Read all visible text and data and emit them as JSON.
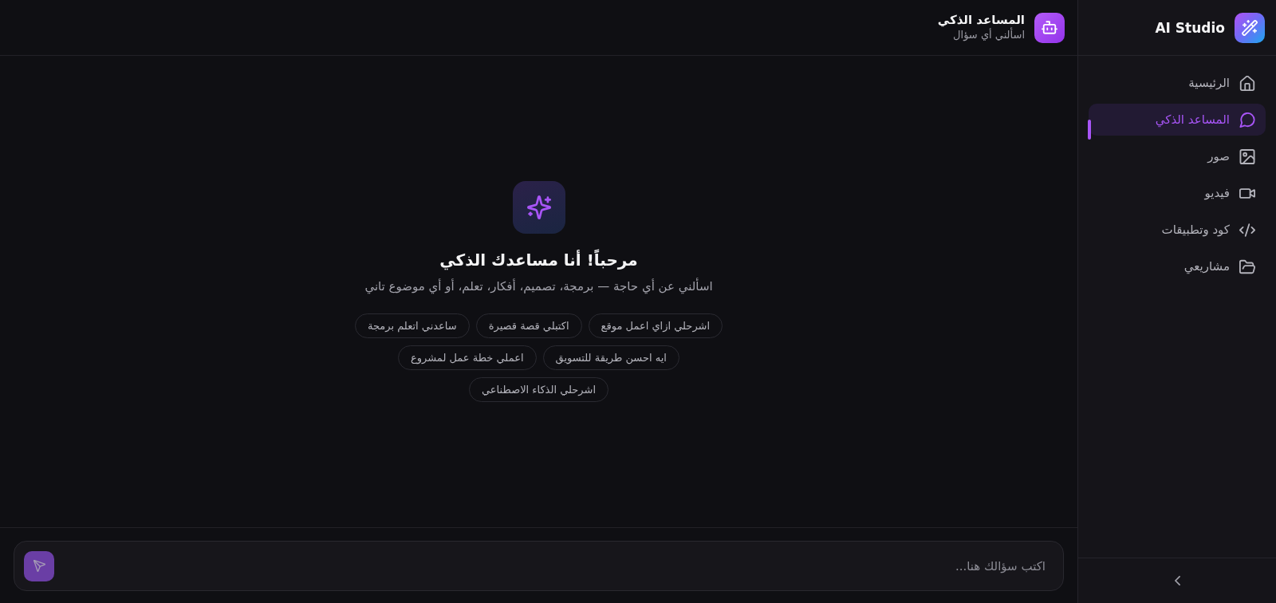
{
  "sidebar": {
    "app_title": "AI Studio",
    "items": [
      {
        "label": "الرئيسية",
        "selected": false
      },
      {
        "label": "المساعد الذكي",
        "selected": true
      },
      {
        "label": "صور",
        "selected": false
      },
      {
        "label": "فيديو",
        "selected": false
      },
      {
        "label": "كود وتطبيقات",
        "selected": false
      },
      {
        "label": "مشاريعي",
        "selected": false
      }
    ]
  },
  "chat_header": {
    "title": "المساعد الذكي",
    "subtitle": "اسألني أي سؤال"
  },
  "welcome": {
    "title": "مرحباً! أنا مساعدك الذكي",
    "subtitle": "اسألني عن أي حاجة — برمجة، تصميم، أفكار، تعلم، أو أي موضوع تاني",
    "suggestions": [
      "اشرحلي ازاي اعمل موقع",
      "اكتبلي قصة قصيرة",
      "ساعدني اتعلم برمجة",
      "ايه احسن طريقة للتسويق",
      "اعملي خطة عمل لمشروع",
      "اشرحلي الذكاء الاصطناعي"
    ]
  },
  "composer": {
    "placeholder": "اكتب سؤالك هنا...",
    "send_button": {
      "disabled": true
    }
  }
}
